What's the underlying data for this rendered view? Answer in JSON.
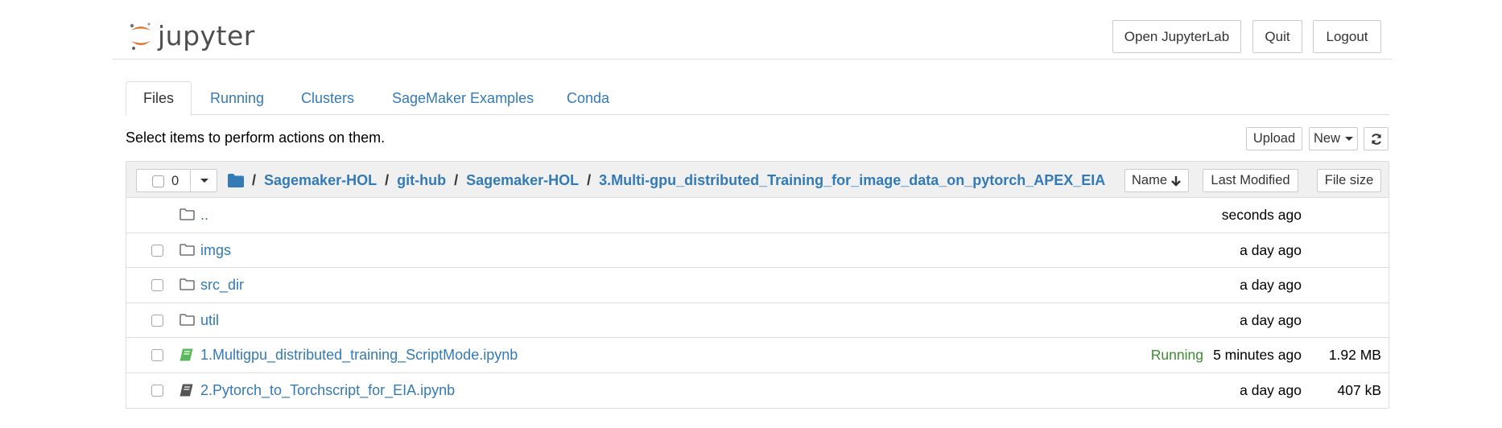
{
  "header": {
    "logo_text": "jupyter",
    "open_lab_label": "Open JupyterLab",
    "quit_label": "Quit",
    "logout_label": "Logout"
  },
  "tabs": [
    {
      "label": "Files",
      "active": true
    },
    {
      "label": "Running",
      "active": false
    },
    {
      "label": "Clusters",
      "active": false
    },
    {
      "label": "SageMaker Examples",
      "active": false
    },
    {
      "label": "Conda",
      "active": false
    }
  ],
  "toolbar": {
    "hint": "Select items to perform actions on them.",
    "upload_label": "Upload",
    "new_label": "New",
    "refresh_icon": "refresh-icon"
  },
  "list_header": {
    "selected_count": "0",
    "breadcrumb": [
      {
        "label": "Sagemaker-HOL"
      },
      {
        "label": "git-hub"
      },
      {
        "label": "Sagemaker-HOL"
      },
      {
        "label": "3.Multi-gpu_distributed_Training_for_image_data_on_pytorch_APEX_EIA"
      }
    ],
    "sort_name_label": "Name",
    "sort_modified_label": "Last Modified",
    "sort_size_label": "File size"
  },
  "rows": [
    {
      "name": "..",
      "type": "folder",
      "status": "",
      "modified": "seconds ago",
      "size": ""
    },
    {
      "name": "imgs",
      "type": "folder",
      "status": "",
      "modified": "a day ago",
      "size": ""
    },
    {
      "name": "src_dir",
      "type": "folder",
      "status": "",
      "modified": "a day ago",
      "size": ""
    },
    {
      "name": "util",
      "type": "folder",
      "status": "",
      "modified": "a day ago",
      "size": ""
    },
    {
      "name": "1.Multigpu_distributed_training_ScriptMode.ipynb",
      "type": "notebook-running",
      "status": "Running",
      "modified": "5 minutes ago",
      "size": "1.92 MB"
    },
    {
      "name": "2.Pytorch_to_Torchscript_for_EIA.ipynb",
      "type": "notebook",
      "status": "",
      "modified": "a day ago",
      "size": "407 kB"
    }
  ],
  "colors": {
    "link": "#337ab7",
    "running": "#3c8b31",
    "logo_orange": "#e46e2e",
    "notebook_running_icon": "#5cb85c",
    "notebook_icon": "#555555"
  }
}
